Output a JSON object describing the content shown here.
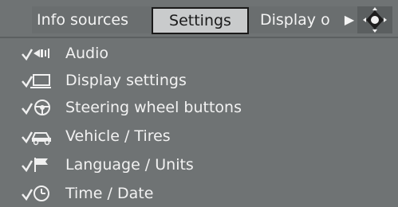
{
  "tabs": {
    "info_sources": "Info sources",
    "settings": "Settings",
    "display_options": "Display o"
  },
  "menu": {
    "items": [
      {
        "label": "Audio",
        "icon": "audio-icon"
      },
      {
        "label": "Display settings",
        "icon": "display-settings-icon"
      },
      {
        "label": "Steering wheel buttons",
        "icon": "steering-wheel-icon"
      },
      {
        "label": "Vehicle / Tires",
        "icon": "vehicle-icon"
      },
      {
        "label": "Language / Units",
        "icon": "language-icon"
      },
      {
        "label": "Time / Date",
        "icon": "clock-icon"
      }
    ]
  },
  "colors": {
    "background": "#6f7374",
    "text": "#f2f2f2",
    "selected_tab_bg": "#c9cbcc",
    "selected_tab_text": "#1a1a1a"
  }
}
